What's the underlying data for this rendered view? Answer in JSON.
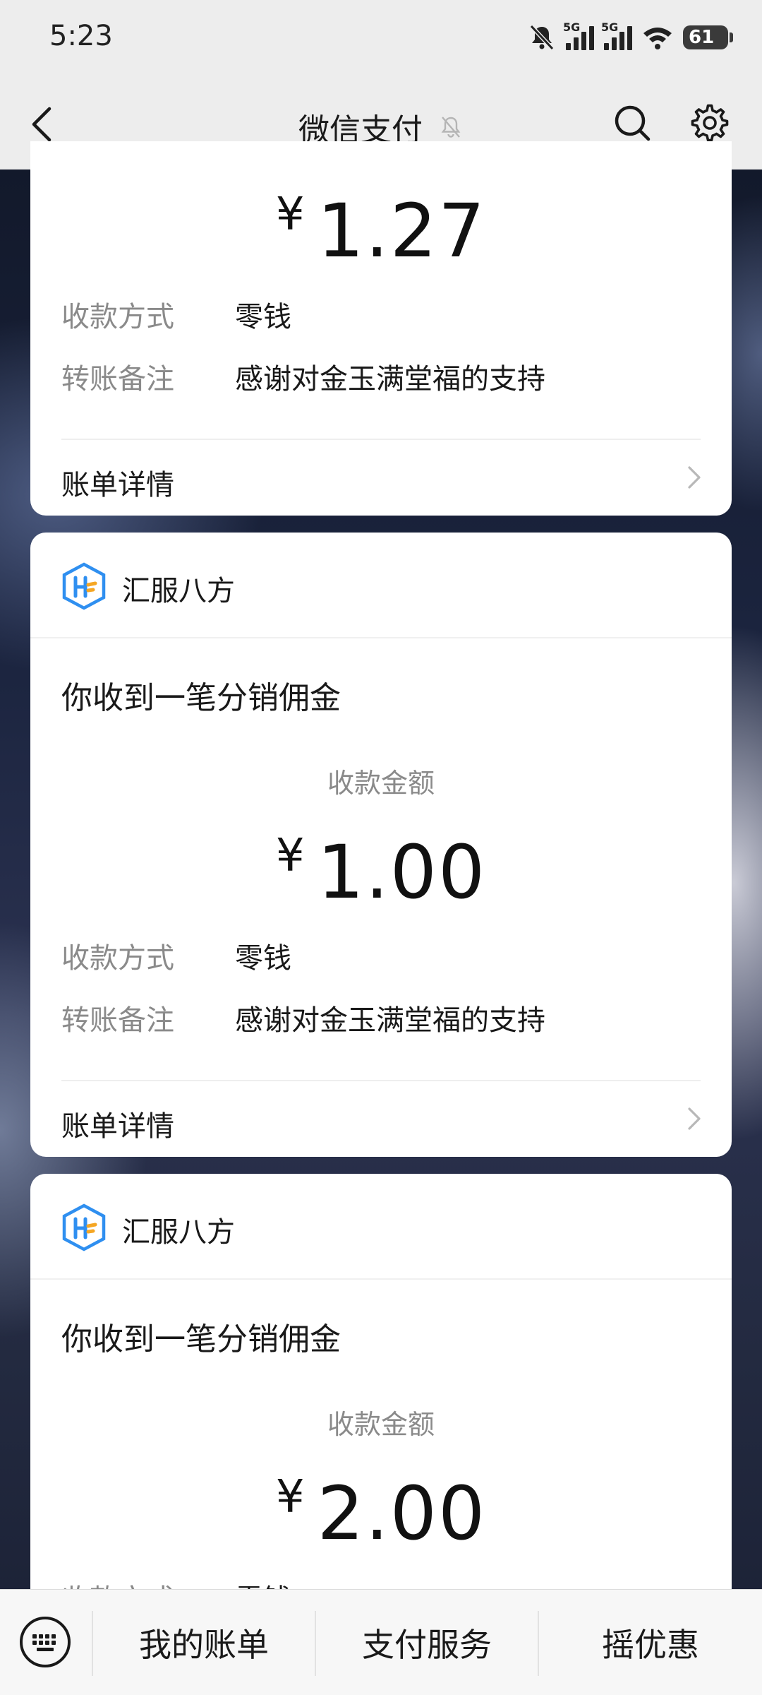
{
  "status_bar": {
    "time": "5:23",
    "network1": "5G",
    "network2": "5G",
    "battery": "61"
  },
  "header": {
    "title": "微信支付"
  },
  "cards": [
    {
      "amount_currency": "¥",
      "amount_value": "1.27",
      "method_label": "收款方式",
      "method_value": "零钱",
      "note_label": "转账备注",
      "note_value": "感谢对金玉满堂福的支持",
      "detail_label": "账单详情"
    },
    {
      "merchant": "汇服八方",
      "title": "你收到一笔分销佣金",
      "amount_label": "收款金额",
      "amount_currency": "¥",
      "amount_value": "1.00",
      "method_label": "收款方式",
      "method_value": "零钱",
      "note_label": "转账备注",
      "note_value": "感谢对金玉满堂福的支持",
      "detail_label": "账单详情"
    },
    {
      "merchant": "汇服八方",
      "title": "你收到一笔分销佣金",
      "amount_label": "收款金额",
      "amount_currency": "¥",
      "amount_value": "2.00",
      "method_label": "收款方式",
      "method_value": "零钱"
    }
  ],
  "bottom_menu": {
    "items": [
      "我的账单",
      "支付服务",
      "摇优惠"
    ]
  },
  "colors": {
    "header_bg": "#ededed",
    "card_bg": "#ffffff",
    "text_primary": "#191919",
    "text_secondary": "#8a8a8a",
    "logo_blue": "#2f8ff0",
    "logo_orange": "#f5a623"
  },
  "icons": [
    "back-icon",
    "mute-icon",
    "search-icon",
    "gear-icon",
    "chevron-right-icon",
    "keyboard-icon",
    "merchant-logo"
  ]
}
